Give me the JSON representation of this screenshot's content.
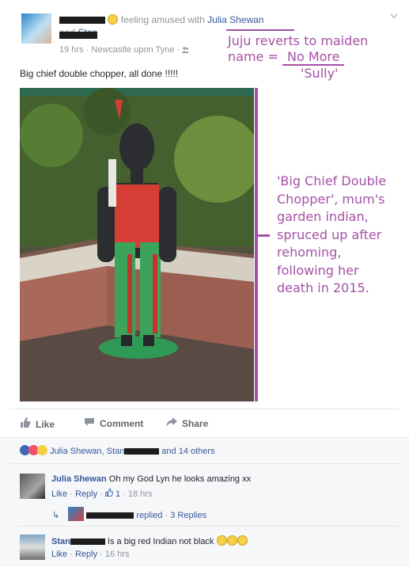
{
  "post": {
    "feeling_text": "feeling amused with",
    "tagged_1": "Julia Shewan",
    "and": "and",
    "tagged_2": "Stan",
    "time": "19 hrs",
    "sep": "·",
    "location": "Newcastle upon Tyne",
    "location_sep": "·",
    "body": "Big chief double chopper, all done !!!!!"
  },
  "annotations": {
    "top_line1": "Juju reverts to maiden",
    "top_line2_prefix": "name =",
    "top_line2_link": "No More",
    "top_line3": "'Sully'",
    "side_lines": [
      "'Big Chief Double",
      "Chopper', mum's",
      "garden indian,",
      "spruced up after",
      "rehoming,",
      "following her",
      "death in 2015."
    ]
  },
  "actions": {
    "like": "Like",
    "comment": "Comment",
    "share": "Share"
  },
  "reactions": {
    "names_1": "Julia Shewan, Stan",
    "names_2": "and 14 others"
  },
  "comments": [
    {
      "author": "Julia Shewan",
      "text": "Oh my God Lyn he looks amazing xx",
      "like": "Like",
      "reply": "Reply",
      "likes_count": "1",
      "time": "18 hrs",
      "sep": "·"
    },
    {
      "replied": "replied",
      "replies": "3 Replies",
      "sep": "·"
    },
    {
      "author": "Stan",
      "text": "Is a big red Indian not black",
      "like": "Like",
      "reply": "Reply",
      "time": "16 hrs",
      "sep": "·"
    }
  ],
  "colors": {
    "annotation": "#a451a6",
    "link": "#365899",
    "meta": "#90949c"
  },
  "icons": [
    "smile-icon",
    "friends-icon",
    "chevron-down-icon",
    "like-icon",
    "comment-icon",
    "share-icon",
    "reply-arrow-icon",
    "emoji-icon"
  ]
}
